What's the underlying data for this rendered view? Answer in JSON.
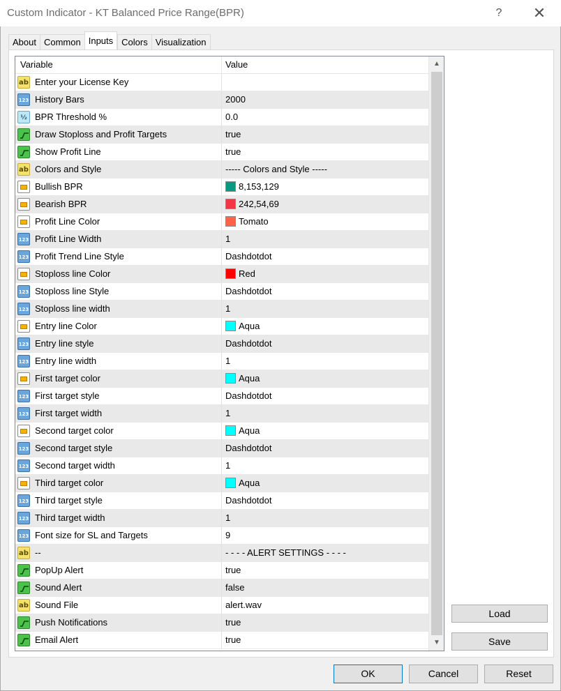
{
  "window": {
    "title": "Custom Indicator - KT Balanced Price Range(BPR)",
    "help_glyph": "?",
    "close_glyph": "✕"
  },
  "tabs": [
    {
      "label": "About"
    },
    {
      "label": "Common"
    },
    {
      "label": "Inputs",
      "active": true
    },
    {
      "label": "Colors"
    },
    {
      "label": "Visualization"
    }
  ],
  "grid": {
    "headers": {
      "variable": "Variable",
      "value": "Value"
    },
    "rows": [
      {
        "icon": "text-icon",
        "variable": "Enter your License Key",
        "value": ""
      },
      {
        "icon": "integer-icon",
        "variable": "History Bars",
        "value": "2000"
      },
      {
        "icon": "double-icon",
        "variable": "BPR Threshold %",
        "value": "0.0"
      },
      {
        "icon": "boolean-icon",
        "variable": "Draw Stoploss and Profit Targets",
        "value": "true"
      },
      {
        "icon": "boolean-icon",
        "variable": "Show Profit Line",
        "value": "true"
      },
      {
        "icon": "text-icon",
        "variable": "Colors and Style",
        "value": "----- Colors and Style -----"
      },
      {
        "icon": "color-icon",
        "variable": "Bullish BPR",
        "value": "8,153,129",
        "swatch": "#089981"
      },
      {
        "icon": "color-icon",
        "variable": "Bearish BPR",
        "value": "242,54,69",
        "swatch": "#f23645"
      },
      {
        "icon": "color-icon",
        "variable": "Profit Line Color",
        "value": "Tomato",
        "swatch": "#ff6347"
      },
      {
        "icon": "integer-icon",
        "variable": "Profit Line Width",
        "value": "1"
      },
      {
        "icon": "integer-icon",
        "variable": "Profit Trend Line Style",
        "value": "Dashdotdot"
      },
      {
        "icon": "color-icon",
        "variable": "Stoploss line Color",
        "value": "Red",
        "swatch": "#ff0000"
      },
      {
        "icon": "integer-icon",
        "variable": "Stoploss line Style",
        "value": "Dashdotdot"
      },
      {
        "icon": "integer-icon",
        "variable": "Stoploss line width",
        "value": "1"
      },
      {
        "icon": "color-icon",
        "variable": "Entry line Color",
        "value": "Aqua",
        "swatch": "#00ffff"
      },
      {
        "icon": "integer-icon",
        "variable": "Entry line style",
        "value": "Dashdotdot"
      },
      {
        "icon": "integer-icon",
        "variable": "Entry line width",
        "value": "1"
      },
      {
        "icon": "color-icon",
        "variable": "First target color",
        "value": "Aqua",
        "swatch": "#00ffff"
      },
      {
        "icon": "integer-icon",
        "variable": "First target style",
        "value": "Dashdotdot"
      },
      {
        "icon": "integer-icon",
        "variable": "First target width",
        "value": "1"
      },
      {
        "icon": "color-icon",
        "variable": "Second target color",
        "value": "Aqua",
        "swatch": "#00ffff"
      },
      {
        "icon": "integer-icon",
        "variable": "Second target style",
        "value": "Dashdotdot"
      },
      {
        "icon": "integer-icon",
        "variable": "Second target width",
        "value": "1"
      },
      {
        "icon": "color-icon",
        "variable": "Third target color",
        "value": "Aqua",
        "swatch": "#00ffff"
      },
      {
        "icon": "integer-icon",
        "variable": "Third target style",
        "value": "Dashdotdot"
      },
      {
        "icon": "integer-icon",
        "variable": "Third target width",
        "value": "1"
      },
      {
        "icon": "integer-icon",
        "variable": "Font size for SL and Targets",
        "value": "9"
      },
      {
        "icon": "text-icon",
        "variable": "--",
        "value": "- - - - ALERT SETTINGS - - - -"
      },
      {
        "icon": "boolean-icon",
        "variable": "PopUp Alert",
        "value": "true"
      },
      {
        "icon": "boolean-icon",
        "variable": "Sound Alert",
        "value": "false"
      },
      {
        "icon": "text-icon",
        "variable": "Sound File",
        "value": "alert.wav"
      },
      {
        "icon": "boolean-icon",
        "variable": "Push Notifications",
        "value": "true"
      },
      {
        "icon": "boolean-icon",
        "variable": "Email Alert",
        "value": "true"
      }
    ]
  },
  "icon_labels": {
    "text": "ab",
    "integer": "123",
    "double": "½"
  },
  "scrollbar": {
    "up_glyph": "▲",
    "down_glyph": "▼"
  },
  "side_buttons": {
    "load": "Load",
    "save": "Save"
  },
  "footer": {
    "ok": "OK",
    "cancel": "Cancel",
    "reset": "Reset"
  }
}
